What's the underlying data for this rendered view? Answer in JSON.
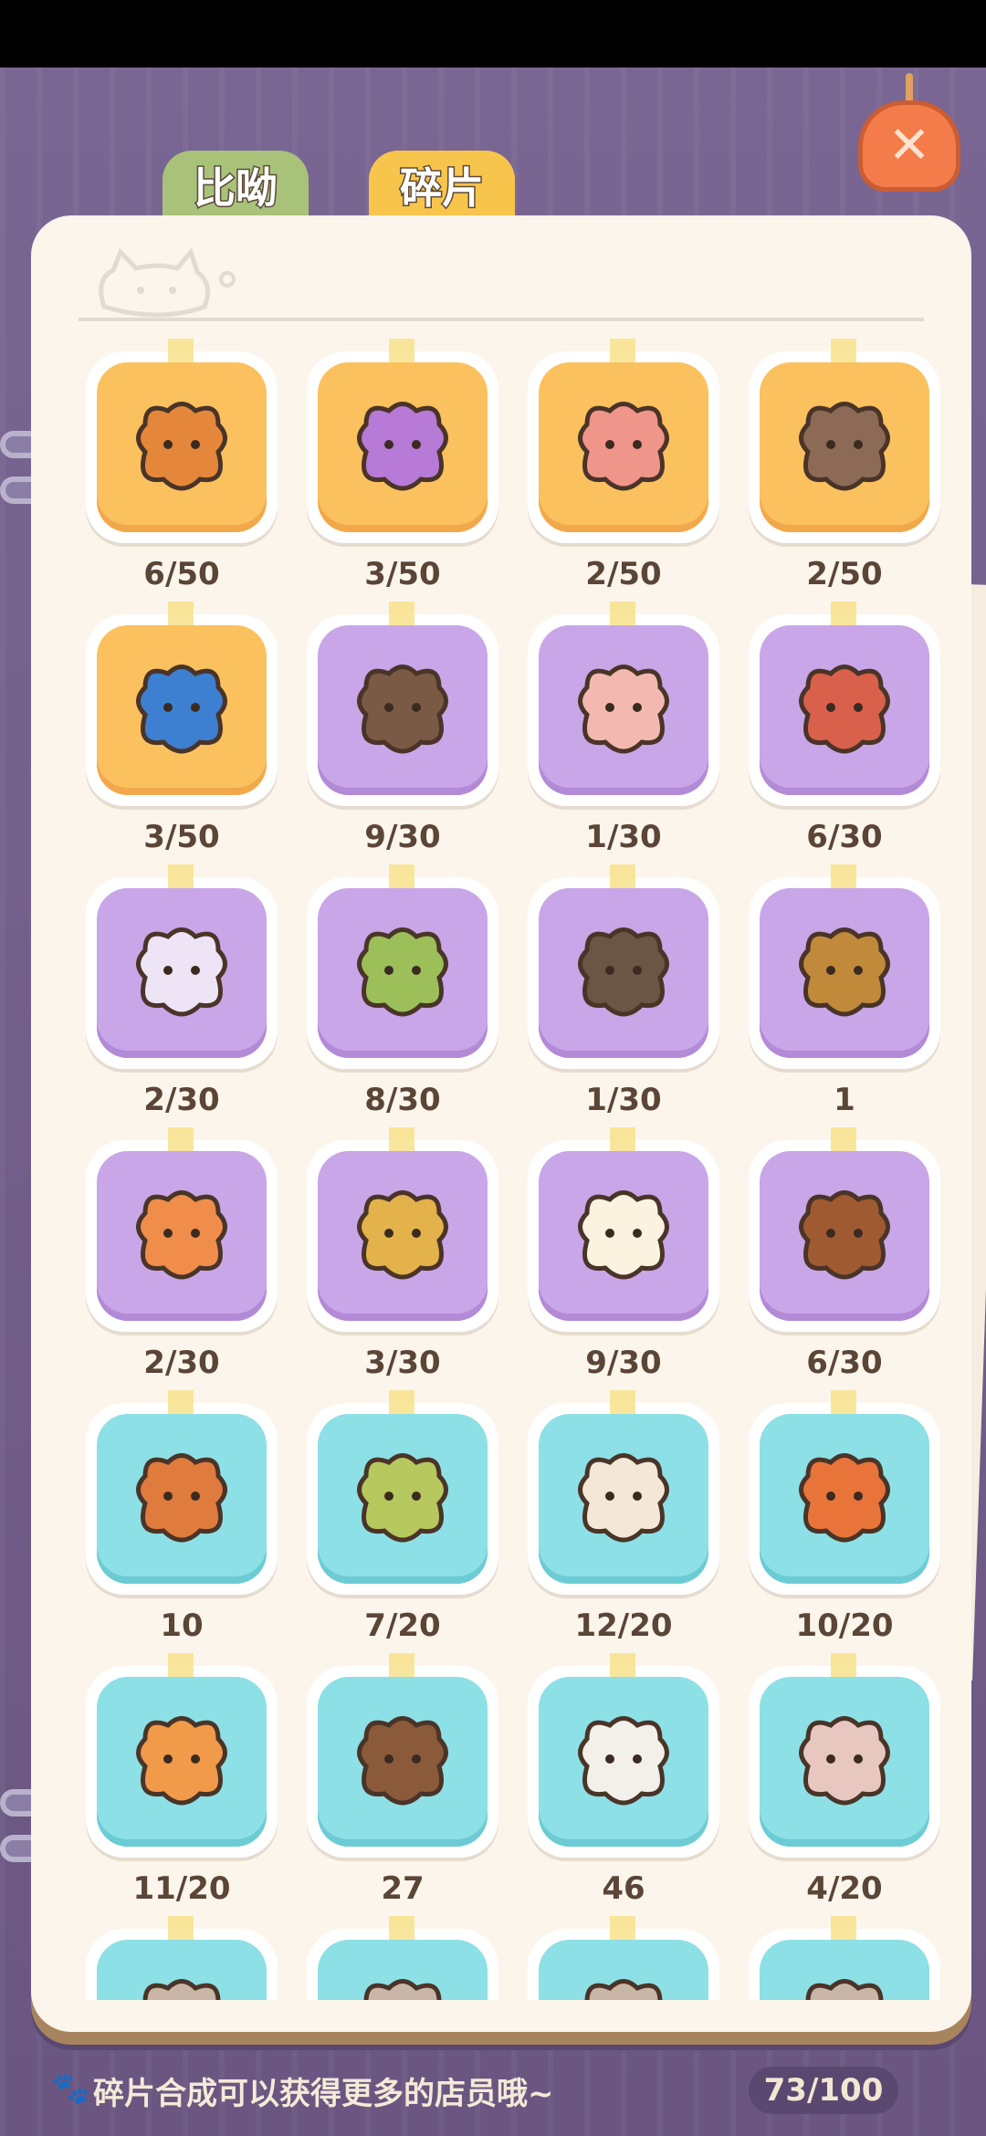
{
  "tabs": {
    "bia": "比呦",
    "sui": "碎片",
    "active": "sui"
  },
  "close_button": {
    "icon": "close-icon"
  },
  "header_icon": "cat-doodle-icon",
  "colors": {
    "orange": "#fbc15f",
    "purple": "#c9a6e8",
    "cyan": "#8de0e6"
  },
  "cards": [
    {
      "label": "6/50",
      "color": "orange",
      "icon": "orange-monster-puzzle-piece-icon"
    },
    {
      "label": "3/50",
      "color": "orange",
      "icon": "purple-dress-puzzle-piece-icon"
    },
    {
      "label": "2/50",
      "color": "orange",
      "icon": "heart-eyes-puzzle-piece-icon"
    },
    {
      "label": "2/50",
      "color": "orange",
      "icon": "skull-puzzle-piece-icon"
    },
    {
      "label": "3/50",
      "color": "orange",
      "icon": "blue-cat-puzzle-piece-icon"
    },
    {
      "label": "9/30",
      "color": "purple",
      "icon": "bow-cat-puzzle-piece-icon"
    },
    {
      "label": "1/30",
      "color": "purple",
      "icon": "pink-cat-puzzle-piece-icon"
    },
    {
      "label": "6/30",
      "color": "purple",
      "icon": "red-mushroom-puzzle-piece-icon"
    },
    {
      "label": "2/30",
      "color": "purple",
      "icon": "ghost-puzzle-piece-icon"
    },
    {
      "label": "8/30",
      "color": "purple",
      "icon": "green-mushroom-puzzle-piece-icon"
    },
    {
      "label": "1/30",
      "color": "purple",
      "icon": "frog-hat-puzzle-piece-icon"
    },
    {
      "label": "1",
      "color": "purple",
      "icon": "straw-hat-cat-icon"
    },
    {
      "label": "2/30",
      "color": "purple",
      "icon": "tiger-puzzle-piece-icon"
    },
    {
      "label": "3/30",
      "color": "purple",
      "icon": "samurai-helmet-puzzle-piece-icon"
    },
    {
      "label": "9/30",
      "color": "purple",
      "icon": "white-cat-puzzle-piece-icon"
    },
    {
      "label": "6/30",
      "color": "purple",
      "icon": "brown-cat-puzzle-piece-icon"
    },
    {
      "label": "10",
      "color": "cyan",
      "icon": "lion-mane-cat-icon"
    },
    {
      "label": "7/20",
      "color": "cyan",
      "icon": "green-cat-puzzle-piece-icon"
    },
    {
      "label": "12/20",
      "color": "cyan",
      "icon": "chef-cat-puzzle-piece-icon"
    },
    {
      "label": "10/20",
      "color": "cyan",
      "icon": "crown-cat-puzzle-piece-icon"
    },
    {
      "label": "11/20",
      "color": "cyan",
      "icon": "witch-hat-cat-puzzle-piece-icon"
    },
    {
      "label": "27",
      "color": "cyan",
      "icon": "hooded-cat-icon"
    },
    {
      "label": "46",
      "color": "cyan",
      "icon": "police-cat-icon"
    },
    {
      "label": "4/20",
      "color": "cyan",
      "icon": "pink-cat-puzzle-piece-icon"
    },
    {
      "label": "",
      "color": "cyan",
      "icon": "puzzle-piece-icon"
    },
    {
      "label": "",
      "color": "cyan",
      "icon": "puzzle-piece-icon"
    },
    {
      "label": "",
      "color": "cyan",
      "icon": "puzzle-piece-icon"
    },
    {
      "label": "",
      "color": "cyan",
      "icon": "puzzle-piece-icon"
    }
  ],
  "footer": {
    "paw_icon": "paw-icon",
    "tip": "碎片合成可以获得更多的店员哦~",
    "count": "73/100"
  }
}
